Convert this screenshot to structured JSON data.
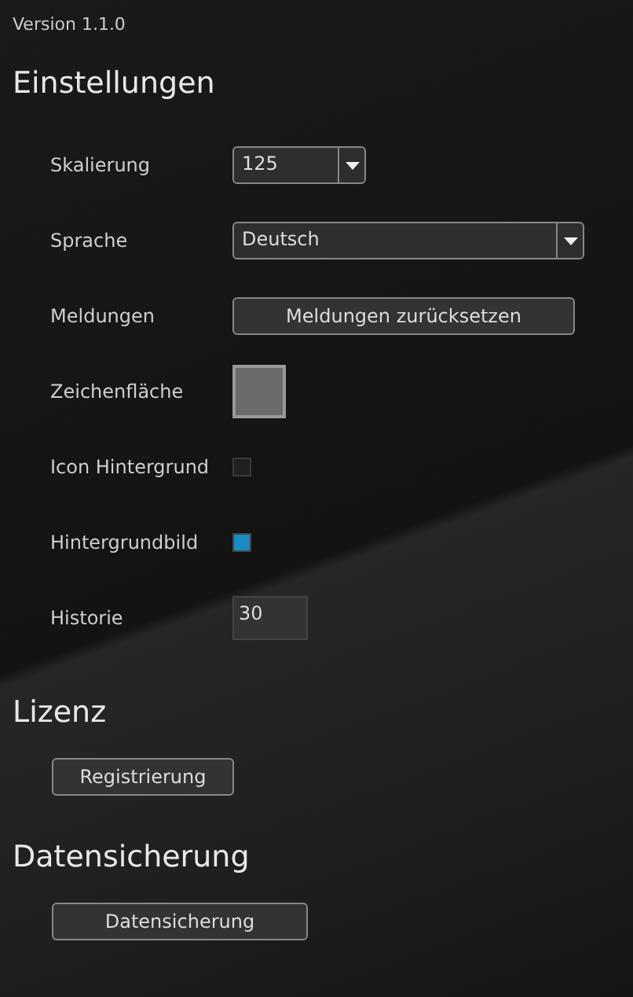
{
  "version": "Version 1.1.0",
  "settings": {
    "title": "Einstellungen",
    "rows": [
      {
        "kind": "dropdown",
        "label": "Skalierung",
        "value": "125",
        "wide": false
      },
      {
        "kind": "dropdown",
        "label": "Sprache",
        "value": "Deutsch",
        "wide": true
      },
      {
        "kind": "button",
        "label": "Meldungen",
        "value": "Meldungen zurücksetzen"
      },
      {
        "kind": "swatch",
        "label": "Zeichenfläche",
        "color": "#6b6b6b"
      },
      {
        "kind": "checkbox",
        "label": "Icon Hintergrund",
        "checked": false
      },
      {
        "kind": "checkbox",
        "label": "Hintergrundbild",
        "checked": true
      },
      {
        "kind": "number",
        "label": "Historie",
        "value": "30"
      }
    ]
  },
  "license": {
    "title": "Lizenz",
    "button": "Registrierung"
  },
  "backup": {
    "title": "Datensicherung",
    "button": "Datensicherung"
  }
}
